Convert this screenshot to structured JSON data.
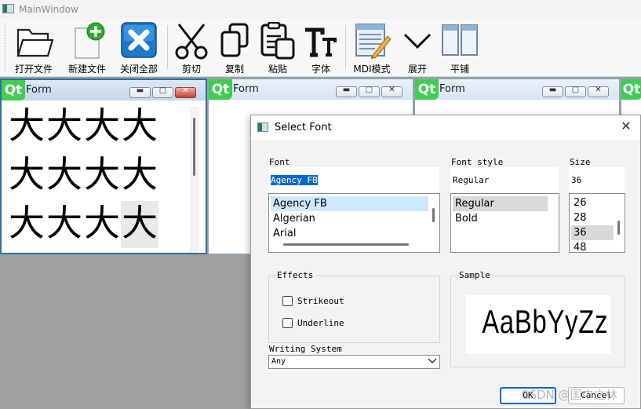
{
  "main_window": {
    "title": "MainWindow"
  },
  "toolbar": {
    "open_file": "打开文件",
    "new_file": "新建文件",
    "close_all": "关闭全部",
    "cut": "剪切",
    "copy": "复制",
    "paste": "粘贴",
    "font": "字体",
    "mdi_mode": "MDI模式",
    "expand": "展开",
    "tile": "平铺"
  },
  "subwindows": [
    {
      "logo": "Qt",
      "title": "Form"
    },
    {
      "logo": "Qt",
      "title": "Form"
    },
    {
      "logo": "Qt",
      "title": "Form"
    },
    {
      "logo": "Qt",
      "title": ""
    }
  ],
  "editor": {
    "glyph": "大",
    "rows": 3,
    "cols": 4
  },
  "dialog": {
    "title": "Select Font",
    "font_label": "Font",
    "font_value": "Agency FB",
    "font_list": [
      "Agency FB",
      "Algerian",
      "Arial"
    ],
    "style_label": "Font style",
    "style_value": "Regular",
    "style_list": [
      "Regular",
      "Bold"
    ],
    "size_label": "Size",
    "size_value": "36",
    "size_list": [
      "26",
      "28",
      "36",
      "48"
    ],
    "effects_label": "Effects",
    "strikeout_label": "Strikeout",
    "underline_label": "Underline",
    "sample_label": "Sample",
    "sample_text": "AaBbYyZz",
    "writing_system_label": "Writing System",
    "writing_system_value": "Any",
    "ok_label": "OK",
    "cancel_label": "Cancel"
  },
  "watermark": "CSDN @国中之林",
  "colors": {
    "qt_green": "#41cd52",
    "selection_blue": "#0a68c8",
    "mdi_background": "#a0a0a0"
  }
}
